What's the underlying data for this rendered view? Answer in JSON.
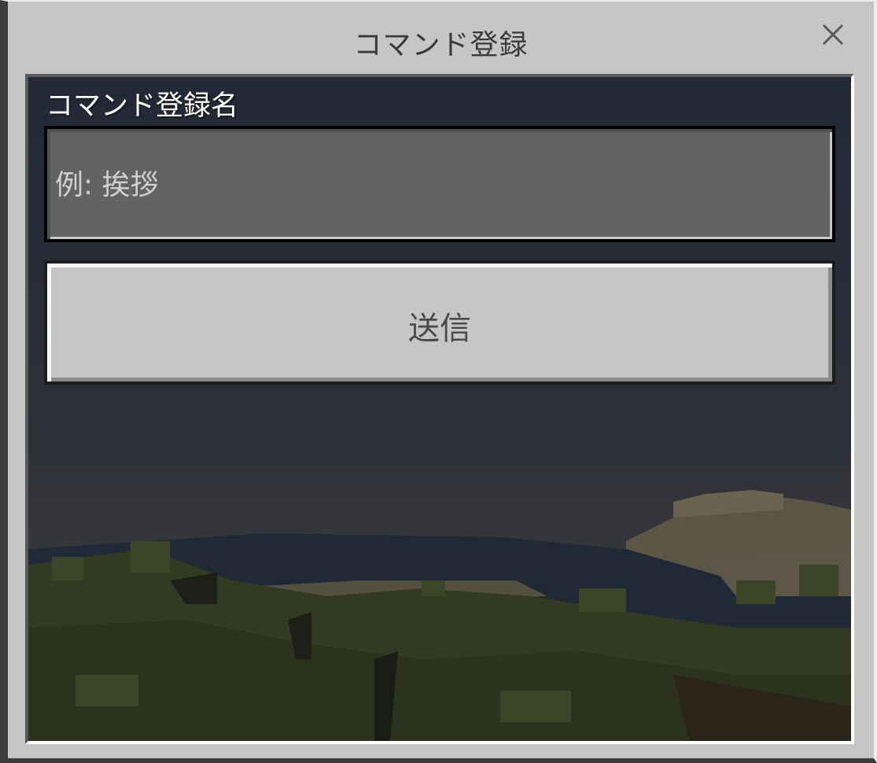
{
  "dialog": {
    "title": "コマンド登録",
    "close_icon": "close-icon"
  },
  "form": {
    "field_label": "コマンド登録名",
    "input_placeholder": "例: 挨拶",
    "input_value": "",
    "submit_label": "送信"
  },
  "colors": {
    "dialog_bg": "#c6c6c6",
    "input_bg": "#636363",
    "button_bg": "#c6c6c6",
    "scene_sky": "#252a36"
  }
}
